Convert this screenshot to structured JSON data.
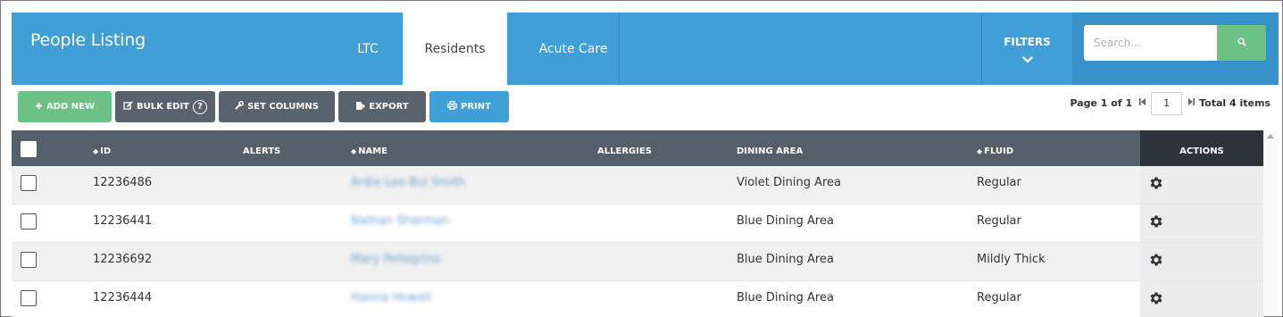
{
  "header": {
    "title": "People Listing",
    "tabs": [
      {
        "label": "LTC",
        "active": false
      },
      {
        "label": "Residents",
        "active": true
      },
      {
        "label": "Acute Care",
        "active": false
      }
    ],
    "filters_label": "FILTERS",
    "search_placeholder": "Search..."
  },
  "toolbar": {
    "add_new": "ADD NEW",
    "bulk_edit": "BULK EDIT",
    "bulk_edit_help": "?",
    "set_columns": "SET COLUMNS",
    "export": "EXPORT",
    "print": "PRINT"
  },
  "pager": {
    "page_text": "Page 1 of 1",
    "current_page": "1",
    "total_text": "Total 4 items"
  },
  "table": {
    "columns": {
      "id": "ID",
      "alerts": "ALERTS",
      "name": "NAME",
      "allergies": "ALLERGIES",
      "dining_area": "DINING AREA",
      "fluid": "FLUID",
      "actions": "ACTIONS"
    },
    "rows": [
      {
        "id": "12236486",
        "name": "Ardie Lee Bui Smith",
        "dining_area": "Violet Dining Area",
        "fluid": "Regular"
      },
      {
        "id": "12236441",
        "name": "Nathan Sherman",
        "dining_area": "Blue Dining Area",
        "fluid": "Regular"
      },
      {
        "id": "12236692",
        "name": "Mary Pellegrino",
        "dining_area": "Blue Dining Area",
        "fluid": "Mildly Thick"
      },
      {
        "id": "12236444",
        "name": "Hanna Howell",
        "dining_area": "Blue Dining Area",
        "fluid": "Regular"
      }
    ]
  },
  "colors": {
    "header_blue": "#3f9fd6",
    "green": "#6cc285",
    "dark_gray": "#59636d",
    "table_header": "#545f69",
    "actions_header": "#2d333a"
  }
}
